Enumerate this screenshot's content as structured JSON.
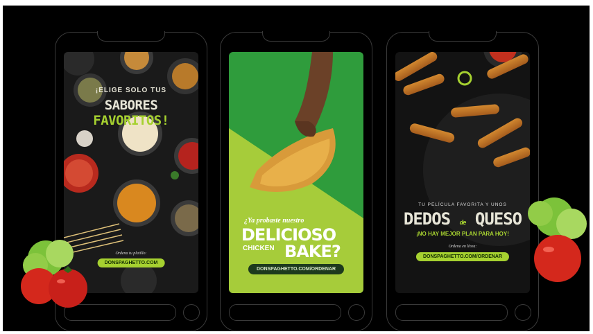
{
  "phones": [
    {
      "headline_top": "¡ELIGE SOLO TUS",
      "headline_a": "SABORES ",
      "headline_b": "FAVORITOS!",
      "cta_label": "Ordena tu platillo:",
      "url": "DONSPAGHETTO.COM"
    },
    {
      "question": "¿Ya probaste nuestro",
      "big_line": "DELICIOSO",
      "small_line_a": "CHICKEN",
      "big_line_2": "BAKE?",
      "url": "DONSPAGHETTO.COM/ORDENAR"
    },
    {
      "tagline": "TU PELÍCULA FAVORITA Y UNOS",
      "headline_a": "DEDOS",
      "headline_de": "de",
      "headline_b": "QUESO",
      "subline": "¡NO HAY MEJOR PLAN PARA HOY!",
      "cta_label": "Ordena en línea:",
      "url": "DONSPAGHETTO.COM/ORDENAR"
    }
  ],
  "colors": {
    "accent_green": "#a6d130",
    "bright_green": "#2f9c3c",
    "background": "#000000"
  }
}
